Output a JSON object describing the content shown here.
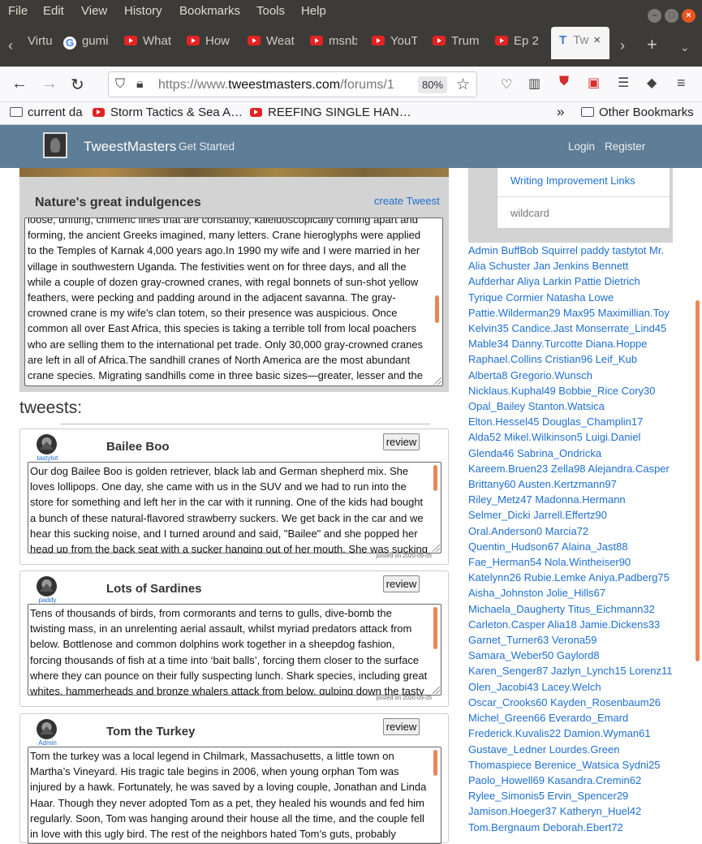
{
  "menu": [
    "File",
    "Edit",
    "View",
    "History",
    "Bookmarks",
    "Tools",
    "Help"
  ],
  "tabs": [
    {
      "label": "Virtu",
      "fav": "none"
    },
    {
      "label": "gumi",
      "fav": "google"
    },
    {
      "label": "What",
      "fav": "youtube"
    },
    {
      "label": "How",
      "fav": "youtube"
    },
    {
      "label": "Weat",
      "fav": "youtube"
    },
    {
      "label": "msnb",
      "fav": "youtube"
    },
    {
      "label": "YouT",
      "fav": "youtube"
    },
    {
      "label": "Trum",
      "fav": "youtube"
    },
    {
      "label": "Ep 2",
      "fav": "youtube"
    },
    {
      "label": "Tw",
      "fav": "T",
      "active": true
    }
  ],
  "urlbar": {
    "prefix": "https://www.",
    "domain": "tweestmasters.com",
    "path": "/forums/1",
    "zoom": "80%"
  },
  "bookmarks": {
    "items": [
      {
        "label": "current da",
        "icon": "folder-icon"
      },
      {
        "label": "Storm Tactics & Sea A…",
        "icon": "youtube-icon"
      },
      {
        "label": "REEFING SINGLE HAN…",
        "icon": "youtube-icon"
      }
    ],
    "overflow": "»",
    "other": "Other Bookmarks"
  },
  "site": {
    "brand": "TweestMasters",
    "get_started": "Get Started",
    "login": "Login",
    "register": "Register"
  },
  "forum": {
    "title": "Nature's great indulgences",
    "create": "create Tweest",
    "description": "loose, drifting, chimeric lines that are constantly, kaleidoscopically coming apart and forming, the ancient Greeks imagined, many letters. Crane hieroglyphs were applied to the Temples of Karnak 4,000 years ago.In 1990 my wife and I were married in her village in southwestern Uganda. The festivities went on for three days, and all the while a couple of dozen gray-crowned cranes, with regal bonnets of sun-shot yellow feathers, were pecking and padding around in the adjacent savanna. The gray-crowned crane is my wife's clan totem, so their presence was auspicious. Once common all over East Africa, this species is taking a terrible toll from local poachers who are selling them to the international pet trade. Only 30,000 gray-crowned cranes are left in all of Africa.The sandhill cranes of North America are the most abundant crane species. Migrating sandhills come in three basic sizes—greater, lesser and the mid-size Canadian. I've"
  },
  "tweets_heading": "tweests:",
  "tweets": [
    {
      "user": "tastytot",
      "title": "Bailee Boo",
      "review": "review",
      "text": "Our dog Bailee Boo is golden retriever, black lab and German shepherd mix. She loves lollipops. One day, she came with us in the SUV and we had to run into the store for something and left her in the car with it running. One of the kids had bought a bunch of these natural-flavored strawberry suckers. We get back in the car and we hear this sucking noise, and I turned around and said, \"Bailee\" and she popped her head up from the back seat with a sucker hanging out of her mouth. She was sucking on it. It",
      "posted": "posted on 2020-09-05"
    },
    {
      "user": "paddy",
      "title": "Lots of Sardines",
      "review": "review",
      "text": "Tens of thousands of birds, from cormorants and terns to gulls, dive-bomb the twisting mass, in an unrelenting aerial assault, whilst myriad predators attack from below. Bottlenose and common dolphins work together in a sheepdog fashion, forcing thousands of fish at a time into ‘bait balls’, forcing them closer to the surface where they can pounce on their fully suspecting lunch. Shark species, including great whites, hammerheads and bronze whalers attack from below, gulping down the tasty fish that",
      "posted": "posted on 2020-09-05"
    },
    {
      "user": "Admin",
      "title": "Tom the Turkey",
      "review": "review",
      "text": "Tom the turkey was a local legend in Chilmark, Massachusetts, a little town on Martha’s Vineyard. His tragic tale begins in 2006, when young orphan Tom was injured by a hawk. Fortunately, he was saved by a loving couple, Jonathan and Linda Haar. Though they never adopted Tom as a pet, they healed his wounds and fed him regularly. Soon, Tom was hanging around their house all the time, and the couple fell in love with this ugly bird. The rest of the neighbors hated Tom’s guts, probably because",
      "posted": ""
    }
  ],
  "sidebar": {
    "links": [
      "Writing Improvement Links",
      "wildcard"
    ],
    "names_lines": [
      "Admin BuffBob Squirrel paddy tastytot Mr.",
      "Alia Schuster Jan Jenkins Bennett",
      "Aufderhar Aliya Larkin Pattie Dietrich",
      "Tyrique Cormier Natasha Lowe",
      "Pattie.Wilderman29 Max95 Maximillian.Toy",
      "Kelvin35 Candice.Jast Monserrate_Lind45",
      "Mable34 Danny.Turcotte Diana.Hoppe",
      "Raphael.Collins Cristian96 Leif_Kub",
      "Alberta8 Gregorio.Wunsch",
      "Nicklaus.Kuphal49 Bobbie_Rice Cory30",
      "Opal_Bailey Stanton.Watsica",
      "Elton.Hessel45 Douglas_Champlin17",
      "Alda52 Mikel.Wilkinson5 Luigi.Daniel",
      "Glenda46 Sabrina_Ondricka",
      "Kareem.Bruen23 Zella98 Alejandra.Casper",
      "Brittany60 Austen.Kertzmann97",
      "Riley_Metz47 Madonna.Hermann",
      "Selmer_Dicki Jarrell.Effertz90",
      "Oral.Anderson0 Marcia72",
      "Quentin_Hudson67 Alaina_Jast88",
      "Fae_Herman54 Nola.Wintheiser90",
      "Katelynn26 Rubie.Lemke Aniya.Padberg75",
      "Aisha_Johnston Jolie_Hills67",
      "Michaela_Daugherty Titus_Eichmann32",
      "Carleton.Casper Alia18 Jamie.Dickens33",
      "Garnet_Turner63 Verona59",
      "Samara_Weber50 Gaylord8",
      "Karen_Senger87 Jazlyn_Lynch15 Lorenz11",
      "Olen_Jacobi43 Lacey.Welch",
      "Oscar_Crooks60 Kayden_Rosenbaum26",
      "Michel_Green66 Everardo_Emard",
      "Frederick.Kuvalis22 Damion.Wyman61",
      "Gustave_Ledner Lourdes.Green",
      "Thomaspiece Berenice_Watsica Sydni25",
      "Paolo_Howell69 Kasandra.Cremin62",
      "Rylee_Simonis5 Ervin_Spencer29",
      "Jamison.Hoeger37 Katheryn_Huel42",
      "Tom.Bergnaum Deborah.Ebert72"
    ]
  },
  "colors": {
    "header": "#5e7d96",
    "link": "#1e6fd0",
    "scrollbar": "#e8875a",
    "panel": "#d3d3d3"
  }
}
